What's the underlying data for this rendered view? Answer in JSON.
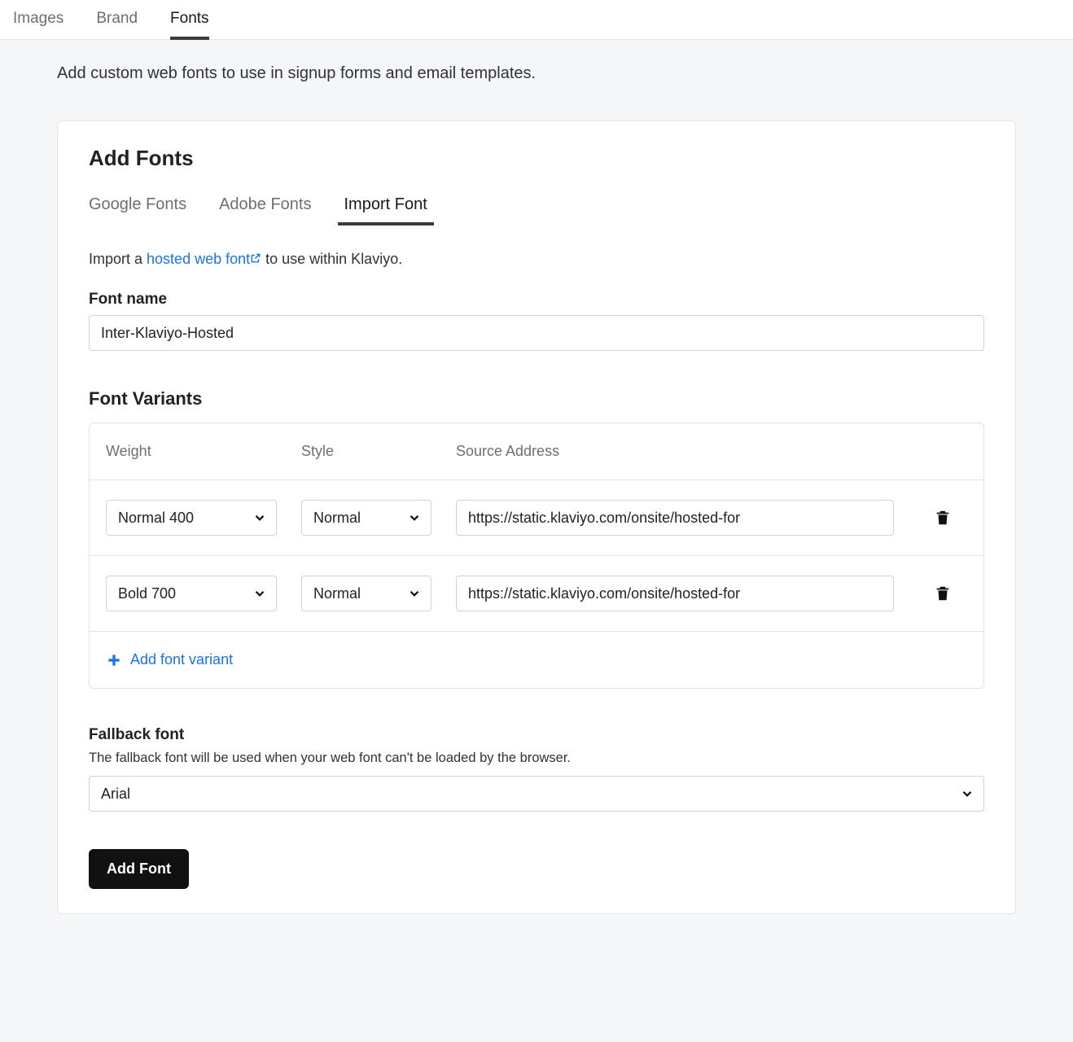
{
  "topTabs": {
    "images": "Images",
    "brand": "Brand",
    "fonts": "Fonts"
  },
  "pageDesc": "Add custom web fonts to use in signup forms and email templates.",
  "card": {
    "title": "Add Fonts",
    "tabs": {
      "google": "Google Fonts",
      "adobe": "Adobe Fonts",
      "import": "Import Font"
    },
    "importHint": {
      "prefix": "Import a ",
      "link": "hosted web font",
      "suffix": " to use within Klaviyo."
    },
    "fontNameLabel": "Font name",
    "fontNameValue": "Inter-Klaviyo-Hosted",
    "variantsTitle": "Font Variants",
    "variantsHeader": {
      "weight": "Weight",
      "style": "Style",
      "source": "Source Address"
    },
    "variants": [
      {
        "weight": "Normal 400",
        "style": "Normal",
        "src": "https://static.klaviyo.com/onsite/hosted-for"
      },
      {
        "weight": "Bold 700",
        "style": "Normal",
        "src": "https://static.klaviyo.com/onsite/hosted-for"
      }
    ],
    "addVariantLabel": "Add font variant",
    "fallback": {
      "label": "Fallback font",
      "help": "The fallback font will be used when your web font can't be loaded by the browser.",
      "value": "Arial"
    },
    "submitLabel": "Add Font"
  }
}
